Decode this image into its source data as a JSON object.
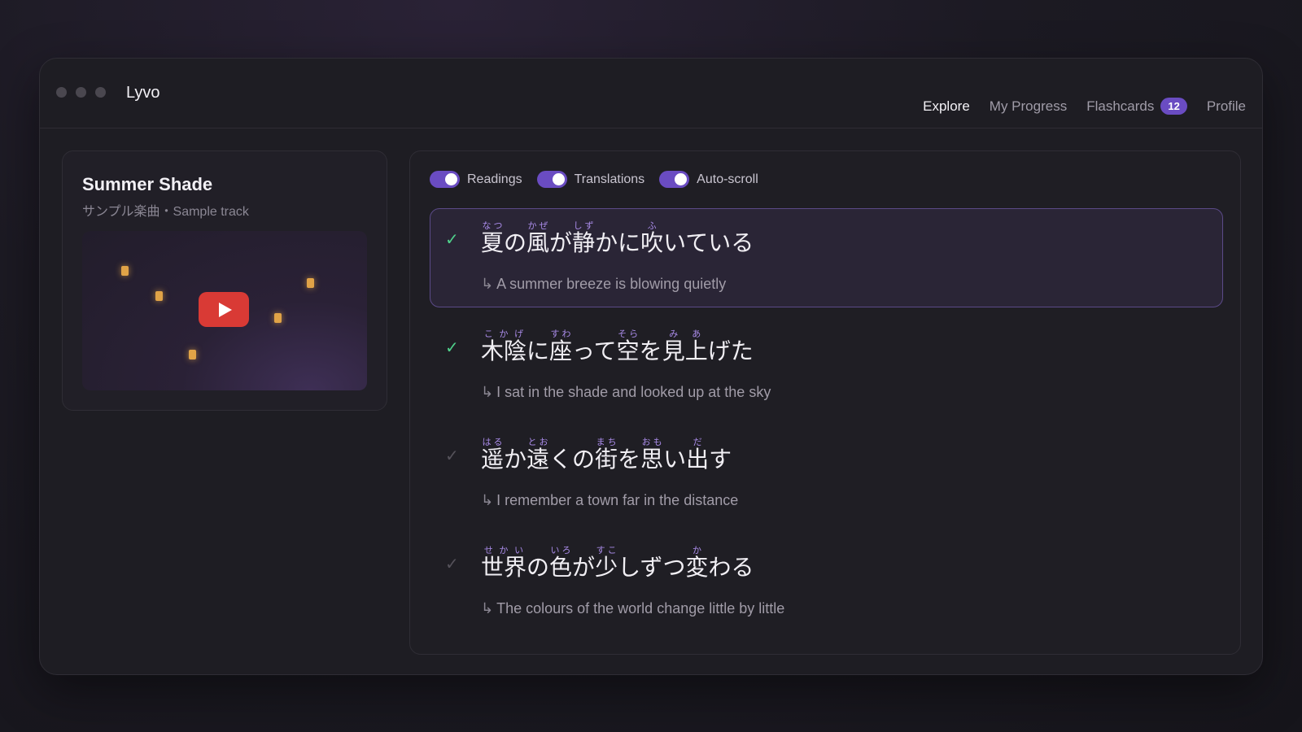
{
  "app": {
    "name": "Lyvo"
  },
  "nav": [
    {
      "label": "Explore",
      "active": true
    },
    {
      "label": "My Progress",
      "active": false
    },
    {
      "label": "Flashcards",
      "active": false,
      "badge": "12"
    },
    {
      "label": "Profile",
      "active": false
    }
  ],
  "song": {
    "title": "Summer Shade",
    "subtitle": "サンプル楽曲・Sample track"
  },
  "toggles": [
    {
      "label": "Readings",
      "on": true
    },
    {
      "label": "Translations",
      "on": true
    },
    {
      "label": "Auto-scroll",
      "on": true
    }
  ],
  "lines": [
    {
      "status": "done",
      "check": "✓",
      "current": true,
      "segments": [
        {
          "base": "夏",
          "reading": "なつ"
        },
        {
          "base": "の"
        },
        {
          "base": "風",
          "reading": "かぜ"
        },
        {
          "base": "が"
        },
        {
          "base": "静",
          "reading": "しず"
        },
        {
          "base": "かに"
        },
        {
          "base": "吹",
          "reading": "ふ"
        },
        {
          "base": "いている"
        }
      ],
      "translation": "A summer breeze is blowing quietly"
    },
    {
      "status": "done",
      "check": "✓",
      "current": false,
      "segments": [
        {
          "base": "木陰",
          "reading": "こかげ"
        },
        {
          "base": "に"
        },
        {
          "base": "座",
          "reading": "すわ"
        },
        {
          "base": "って"
        },
        {
          "base": "空",
          "reading": "そら"
        },
        {
          "base": "を"
        },
        {
          "base": "見",
          "reading": "み"
        },
        {
          "base": "上",
          "reading": "あ"
        },
        {
          "base": "げた"
        }
      ],
      "translation": "I sat in the shade and looked up at the sky"
    },
    {
      "status": "todo",
      "check": "✓",
      "current": false,
      "segments": [
        {
          "base": "遥",
          "reading": "はる"
        },
        {
          "base": "か"
        },
        {
          "base": "遠",
          "reading": "とお"
        },
        {
          "base": "くの"
        },
        {
          "base": "街",
          "reading": "まち"
        },
        {
          "base": "を"
        },
        {
          "base": "思",
          "reading": "おも"
        },
        {
          "base": "い"
        },
        {
          "base": "出",
          "reading": "だ"
        },
        {
          "base": "す"
        }
      ],
      "translation": "I remember a town far in the distance"
    },
    {
      "status": "todo",
      "check": "✓",
      "current": false,
      "segments": [
        {
          "base": "世界",
          "reading": "せかい"
        },
        {
          "base": "の"
        },
        {
          "base": "色",
          "reading": "いろ"
        },
        {
          "base": "が"
        },
        {
          "base": "少",
          "reading": "すこ"
        },
        {
          "base": "しずつ"
        },
        {
          "base": "変",
          "reading": "か"
        },
        {
          "base": "わる"
        }
      ],
      "translation": "The colours of the world change little by little"
    }
  ],
  "colors": {
    "accent": "#6a4cc2",
    "reading": "#a98be8",
    "done_check": "#4fd18b",
    "play_button": "#d93a35"
  },
  "icons": {
    "play": "play-icon",
    "check": "check-icon",
    "translation_arrow": "return-arrow-icon"
  }
}
